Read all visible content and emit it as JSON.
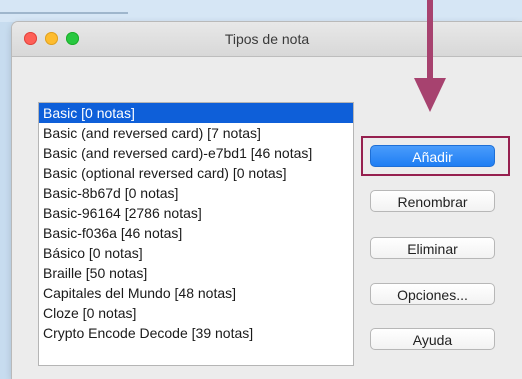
{
  "window": {
    "title": "Tipos de nota"
  },
  "note_types": [
    {
      "label": "Basic [0 notas]",
      "selected": true
    },
    {
      "label": "Basic (and reversed card) [7 notas]",
      "selected": false
    },
    {
      "label": "Basic (and reversed card)-e7bd1 [46 notas]",
      "selected": false
    },
    {
      "label": "Basic (optional reversed card) [0 notas]",
      "selected": false
    },
    {
      "label": "Basic-8b67d [0 notas]",
      "selected": false
    },
    {
      "label": "Basic-96164 [2786 notas]",
      "selected": false
    },
    {
      "label": "Basic-f036a [46 notas]",
      "selected": false
    },
    {
      "label": "Básico [0 notas]",
      "selected": false
    },
    {
      "label": "Braille [50 notas]",
      "selected": false
    },
    {
      "label": "Capitales del Mundo [48 notas]",
      "selected": false
    },
    {
      "label": "Cloze [0 notas]",
      "selected": false
    },
    {
      "label": "Crypto Encode Decode [39 notas]",
      "selected": false
    }
  ],
  "buttons": {
    "add": "Añadir",
    "rename": "Renombrar",
    "delete": "Eliminar",
    "options": "Opciones...",
    "help": "Ayuda"
  },
  "colors": {
    "selection": "#0e5fd9",
    "primary_button": "#1f7ef3",
    "annotation": "#96204f"
  }
}
